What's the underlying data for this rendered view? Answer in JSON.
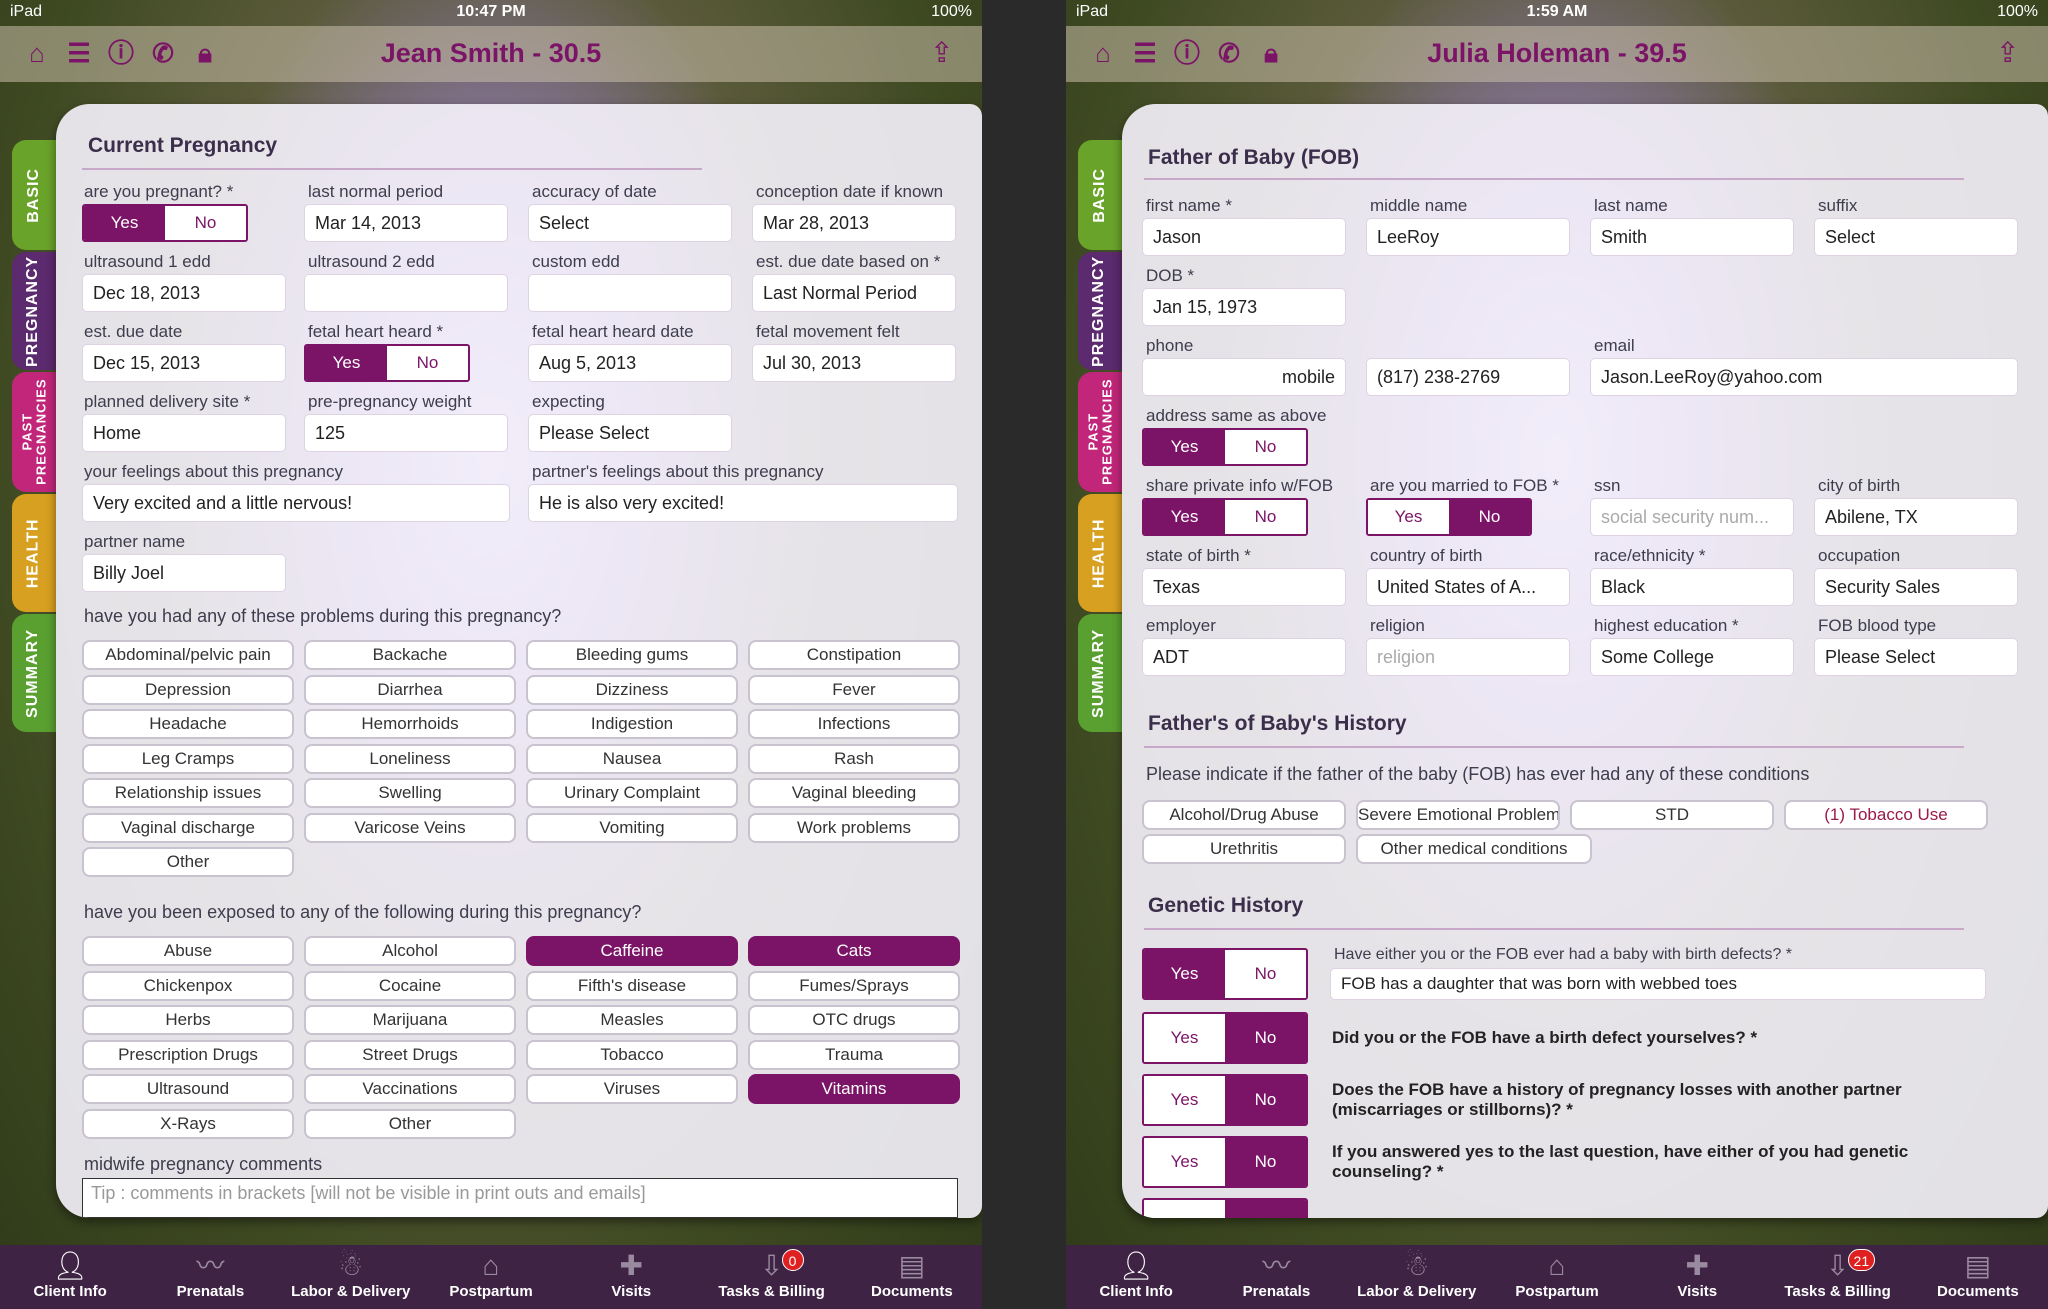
{
  "screens": [
    {
      "status": {
        "device": "iPad",
        "time": "10:47 PM",
        "battery": "100%"
      },
      "title": "Jean Smith - 30.5",
      "section_title": "Current Pregnancy",
      "fields": [
        {
          "label": "are you pregnant? *",
          "value": ""
        },
        {
          "label": "last normal period",
          "value": "Mar 14, 2013"
        },
        {
          "label": "accuracy of date",
          "value": "Select"
        },
        {
          "label": "conception date if known",
          "value": "Mar 28, 2013"
        },
        {
          "label": "ultrasound 1 edd",
          "value": "Dec 18, 2013"
        },
        {
          "label": "ultrasound 2 edd",
          "value": ""
        },
        {
          "label": "custom edd",
          "value": ""
        },
        {
          "label": "est. due date based on *",
          "value": "Last Normal Period"
        },
        {
          "label": "est. due date",
          "value": "Dec 15, 2013"
        },
        {
          "label": "fetal heart heard *",
          "value": ""
        },
        {
          "label": "fetal heart heard date",
          "value": "Aug 5, 2013"
        },
        {
          "label": "fetal movement felt",
          "value": "Jul 30, 2013"
        },
        {
          "label": "planned delivery site *",
          "value": "Home"
        },
        {
          "label": "pre-pregnancy weight",
          "value": "125"
        },
        {
          "label": "expecting",
          "value": "Please Select"
        },
        {
          "label": "your feelings about this pregnancy",
          "value": "Very excited and a little nervous!"
        },
        {
          "label": "partner's feelings about this pregnancy",
          "value": "He is also very excited!"
        },
        {
          "label": "partner name",
          "value": "Billy Joel"
        }
      ],
      "yes": "Yes",
      "no": "No",
      "problems_q": "have you had any of these problems during this pregnancy?",
      "problems": [
        "Abdominal/pelvic pain",
        "Backache",
        "Bleeding gums",
        "Constipation",
        "Depression",
        "Diarrhea",
        "Dizziness",
        "Fever",
        "Headache",
        "Hemorrhoids",
        "Indigestion",
        "Infections",
        "Leg Cramps",
        "Loneliness",
        "Nausea",
        "Rash",
        "Relationship issues",
        "Swelling",
        "Urinary Complaint",
        "Vaginal bleeding",
        "Vaginal discharge",
        "Varicose Veins",
        "Vomiting",
        "Work problems",
        "Other"
      ],
      "exposed_q": "have you been exposed to any of the following during this pregnancy?",
      "exposures": [
        "Abuse",
        "Alcohol",
        "Caffeine",
        "Cats",
        "Chickenpox",
        "Cocaine",
        "Fifth's disease",
        "Fumes/Sprays",
        "Herbs",
        "Marijuana",
        "Measles",
        "OTC drugs",
        "Prescription Drugs",
        "Street Drugs",
        "Tobacco",
        "Trauma",
        "Ultrasound",
        "Vaccinations",
        "Viruses",
        "Vitamins",
        "X-Rays",
        "Other"
      ],
      "comments_label": "midwife pregnancy comments",
      "comments_placeholder": "Tip : comments in brackets [will not be visible in print outs and emails]",
      "tabs": {
        "t0": "Client Info",
        "t1": "Prenatals",
        "t2": "Labor & Delivery",
        "t3": "Postpartum",
        "t4": "Visits",
        "t5": "Tasks & Billing",
        "t6": "Documents"
      },
      "badge": "0"
    },
    {
      "status": {
        "device": "iPad",
        "time": "1:59 AM",
        "battery": "100%"
      },
      "title": "Julia Holeman - 39.5",
      "section_title": "Father of Baby (FOB)",
      "fields": [
        {
          "label": "first name *",
          "value": "Jason"
        },
        {
          "label": "middle name",
          "value": "LeeRoy"
        },
        {
          "label": "last name",
          "value": "Smith"
        },
        {
          "label": "suffix",
          "value": "Select"
        },
        {
          "label": "DOB *",
          "value": "Jan 15, 1973"
        },
        {
          "label": "phone",
          "value": "mobile"
        },
        {
          "label": "",
          "value": "(817) 238-2769"
        },
        {
          "label": "email",
          "value": "Jason.LeeRoy@yahoo.com"
        },
        {
          "label": "address same as above",
          "value": ""
        },
        {
          "label": "share private info w/FOB",
          "value": ""
        },
        {
          "label": "are you married to FOB *",
          "value": ""
        },
        {
          "label": "ssn",
          "value": "social security num..."
        },
        {
          "label": "city of birth",
          "value": "Abilene, TX"
        },
        {
          "label": "state of birth *",
          "value": "Texas"
        },
        {
          "label": "country of birth",
          "value": "United States of A..."
        },
        {
          "label": "race/ethnicity *",
          "value": "Black"
        },
        {
          "label": "occupation",
          "value": "Security Sales"
        },
        {
          "label": "employer",
          "value": "ADT"
        },
        {
          "label": "religion",
          "value": "religion"
        },
        {
          "label": "highest education *",
          "value": "Some College"
        },
        {
          "label": "FOB blood type",
          "value": "Please Select"
        }
      ],
      "yes": "Yes",
      "no": "No",
      "history_title": "Father's of Baby's History",
      "history_q": "Please indicate if the father of the baby (FOB) has ever had any of these conditions",
      "conditions": [
        "Alcohol/Drug Abuse",
        "Severe Emotional Problems",
        "STD",
        "(1) Tobacco Use",
        "Urethritis",
        "Other medical conditions"
      ],
      "genetic_title": "Genetic History",
      "gq1": "Have either you or the FOB ever had a baby with birth defects? *",
      "gq1_answer": "FOB has a daughter that was born with webbed toes",
      "gq2": "Did you or the FOB have a birth defect yourselves? *",
      "gq3a": "Does the FOB have a history of pregnancy losses with another partner",
      "gq3b": "(miscarriages or stillborns)? *",
      "gq4a": "If you answered yes to the last question, have either of you had genetic",
      "gq4b": "counseling? *",
      "tabs": {
        "t0": "Client Info",
        "t1": "Prenatals",
        "t2": "Labor & Delivery",
        "t3": "Postpartum",
        "t4": "Visits",
        "t5": "Tasks & Billing",
        "t6": "Documents"
      },
      "badge": "21"
    }
  ],
  "sidetabs": {
    "basic": "BASIC",
    "pregnancy": "PREGNANCY",
    "past1": "PAST",
    "past2": "PREGNANCIES",
    "health": "HEALTH",
    "summary": "SUMMARY"
  },
  "colors": {
    "accent": "#7b1466",
    "tab_basic": "#6aa32a",
    "tab_pregnancy": "#5c2a6e",
    "tab_past": "#c2267a",
    "tab_health": "#d8a020",
    "tab_summary": "#5aa030"
  },
  "icons": [
    "home-icon",
    "list-icon",
    "info-icon",
    "phone-icon",
    "lock-icon",
    "share-icon"
  ]
}
